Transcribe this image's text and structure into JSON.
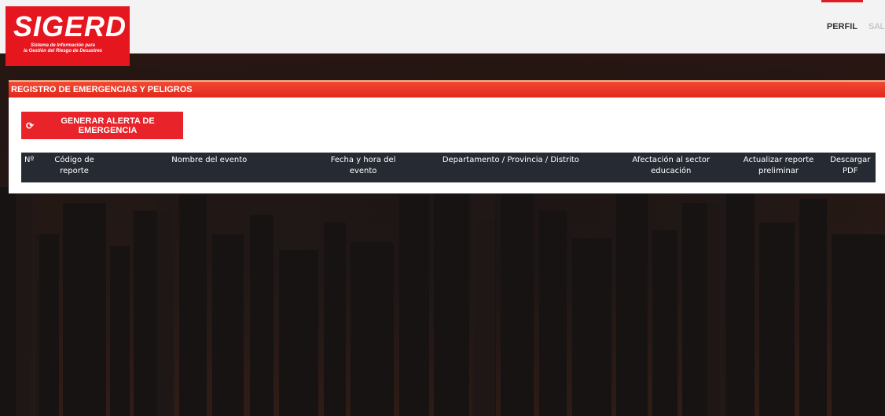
{
  "header": {
    "logo": {
      "title": "SIGERD",
      "subtitle_line1": "Sistema de Información para",
      "subtitle_line2": "la Gestión del Riesgo de Desastres"
    },
    "nav": [
      {
        "label": "PERFIL",
        "active": true
      },
      {
        "label": "SALIR",
        "active": false
      }
    ]
  },
  "panel": {
    "title": "REGISTRO DE EMERGENCIAS Y PELIGROS",
    "alert_button": {
      "icon": "refresh-icon",
      "label": "GENERAR ALERTA DE EMERGENCIA"
    },
    "table": {
      "columns": [
        "Nº",
        "Código de reporte",
        "Nombre del evento",
        "Fecha y hora del evento",
        "Departamento / Provincia / Distrito",
        "Afectación al sector educación",
        "Actualizar reporte preliminar",
        "Descargar PDF"
      ],
      "rows": []
    }
  },
  "colors": {
    "brand_red": "#e6161f",
    "header_bg": "#f3f3f3",
    "table_header_bg": "#262b33"
  }
}
